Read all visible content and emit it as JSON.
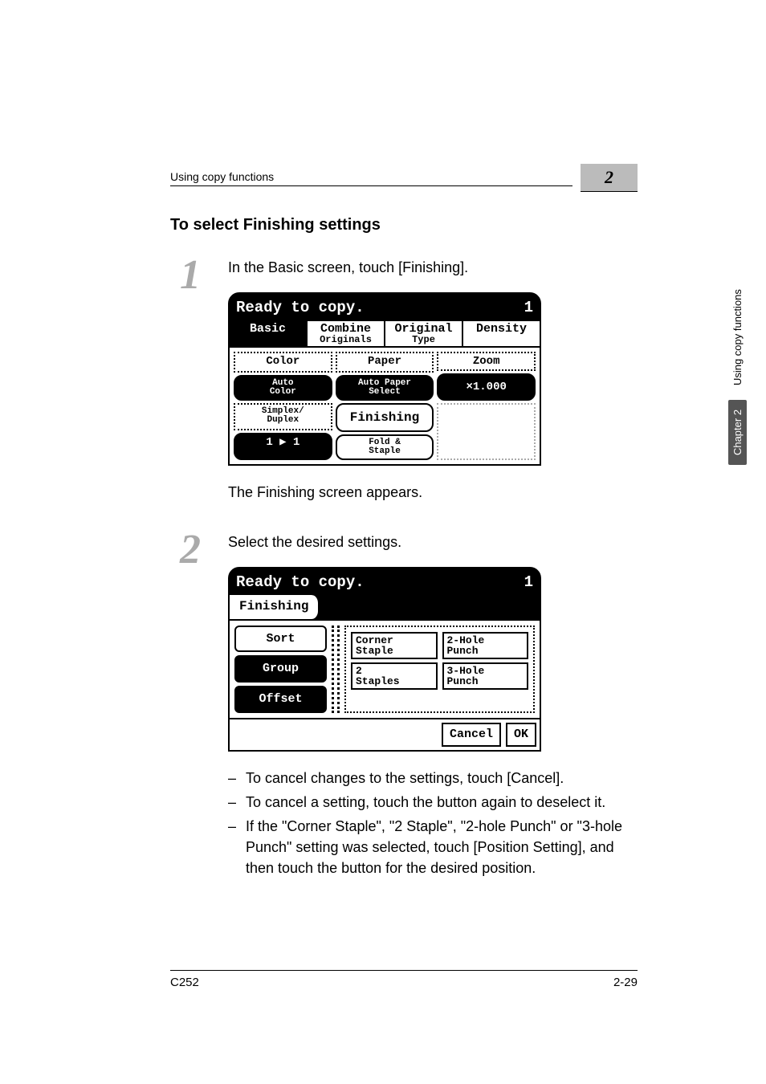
{
  "header": {
    "breadcrumb": "Using copy functions",
    "chapter_num": "2",
    "section_title": "To select Finishing settings"
  },
  "side": {
    "chapter": "Chapter 2",
    "label": "Using copy functions"
  },
  "step1": {
    "num": "1",
    "text": "In the Basic screen, touch [Finishing].",
    "after": "The Finishing screen appears."
  },
  "step2": {
    "num": "2",
    "text": "Select the desired settings.",
    "bullets": [
      "To cancel changes to the settings, touch [Cancel].",
      "To cancel a setting, touch the button again to deselect it.",
      "If the \"Corner Staple\", \"2 Staple\", \"2-hole Punch\" or \"3-hole Punch\" setting was selected, touch [Position Setting], and then touch the button for the desired position."
    ]
  },
  "lcd1": {
    "title": "Ready to copy.",
    "count": "1",
    "tabs": {
      "basic": "Basic",
      "combine_top": "Combine",
      "combine_bot": "Originals",
      "original_top": "Original",
      "original_bot": "Type",
      "density": "Density"
    },
    "color": {
      "label": "Color",
      "value_top": "Auto",
      "value_bot": "Color"
    },
    "paper": {
      "label": "Paper",
      "value_top": "Auto Paper",
      "value_bot": "Select"
    },
    "zoom": {
      "label": "Zoom",
      "value": "×1.000"
    },
    "simplex": {
      "top": "Simplex/",
      "bot": "Duplex",
      "value": "1 ▶ 1"
    },
    "finishing": {
      "label": "Finishing",
      "fold_top": "Fold &",
      "fold_bot": "Staple"
    }
  },
  "lcd2": {
    "title": "Ready to copy.",
    "count": "1",
    "tab": "Finishing",
    "sort": "Sort",
    "group": "Group",
    "offset": "Offset",
    "corner_top": "Corner",
    "corner_bot": "Staple",
    "staples_top": "2",
    "staples_bot": "Staples",
    "hole2_top": "2-Hole",
    "hole2_bot": "Punch",
    "hole3_top": "3-Hole",
    "hole3_bot": "Punch",
    "cancel": "Cancel",
    "ok": "OK"
  },
  "footer": {
    "model": "C252",
    "page": "2-29"
  }
}
